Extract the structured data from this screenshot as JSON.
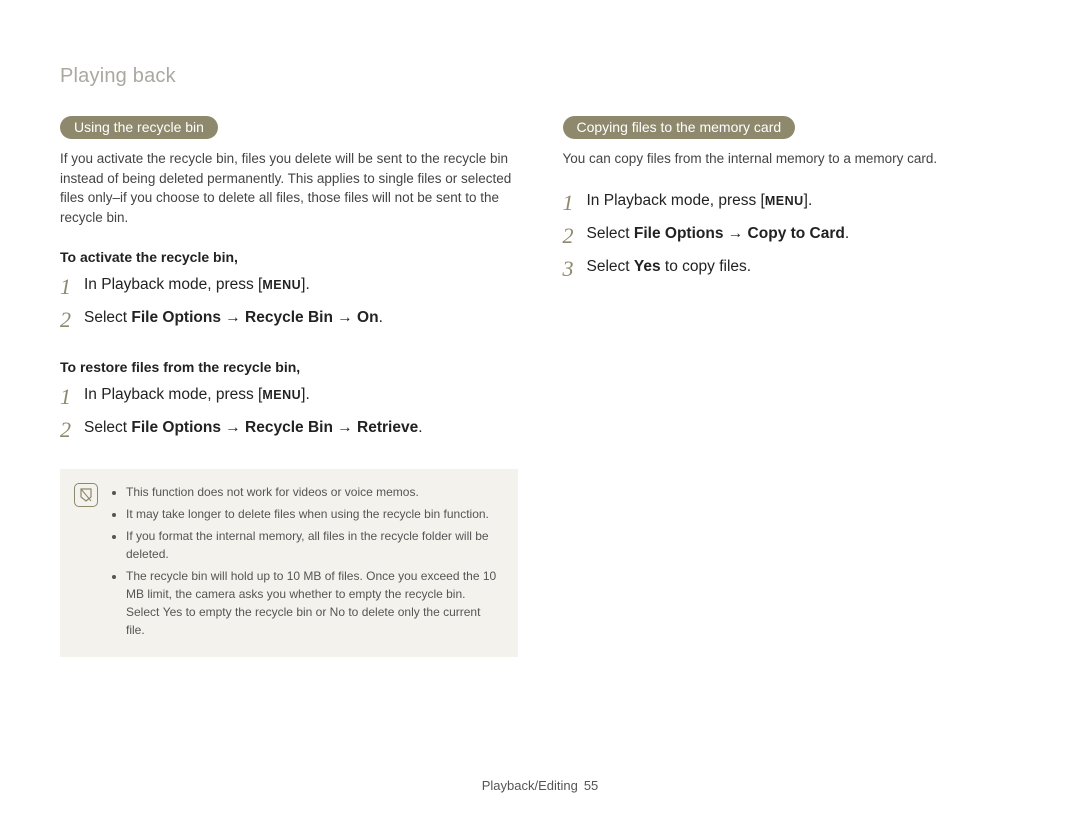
{
  "header": {
    "title": "Playing back"
  },
  "left": {
    "pill": "Using the recycle bin",
    "desc": "If you activate the recycle bin, files you delete will be sent to the recycle bin instead of being deleted permanently. This applies to single files or selected files only–if you choose to delete all files, those files will not be sent to the recycle bin.",
    "sub1": "To activate the recycle bin,",
    "step1a_pre": "In Playback mode, press [",
    "step1a_menu": "MENU",
    "step1a_post": "].",
    "step2a_pre": "Select ",
    "step2a_bold": "File Options → Recycle Bin → On",
    "step2a_post": ".",
    "sub2": "To restore files from the recycle bin,",
    "step1b_pre": "In Playback mode, press [",
    "step1b_menu": "MENU",
    "step1b_post": "].",
    "step2b_pre": "Select ",
    "step2b_bold": "File Options → Recycle Bin → Retrieve",
    "step2b_post": ".",
    "note1": "This function does not work for videos or voice memos.",
    "note2": "It may take longer to delete files when using the recycle bin function.",
    "note3": "If you format the internal memory, all files in the recycle folder will be deleted.",
    "note4a": "The recycle bin will hold up to 10 MB of files. Once you exceed the 10 MB limit, the camera asks you whether to empty the recycle bin. Select ",
    "note4_yes": "Yes",
    "note4b": " to empty the recycle bin or ",
    "note4_no": "No",
    "note4c": " to delete only the current file."
  },
  "right": {
    "pill": "Copying files to the memory card",
    "desc": "You can copy files from the internal memory to a memory card.",
    "step1_pre": "In Playback mode, press [",
    "step1_menu": "MENU",
    "step1_post": "].",
    "step2_pre": "Select ",
    "step2_bold": "File Options → Copy to Card",
    "step2_post": ".",
    "step3_pre": "Select ",
    "step3_yes": "Yes",
    "step3_post": " to copy files."
  },
  "footer": {
    "section": "Playback/Editing",
    "page": "55"
  }
}
